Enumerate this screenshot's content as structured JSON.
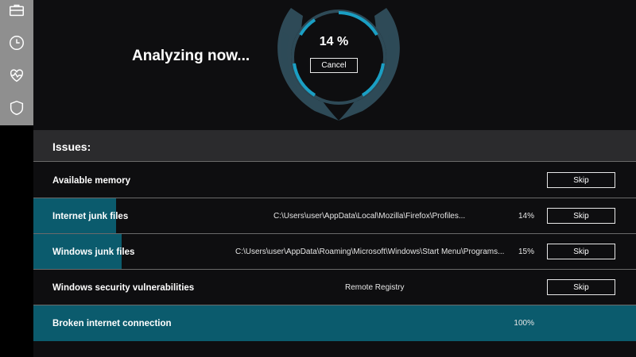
{
  "sidebar": {
    "items": [
      {
        "icon": "briefcase-icon"
      },
      {
        "icon": "clock-icon"
      },
      {
        "icon": "heartbeat-icon"
      },
      {
        "icon": "shield-icon"
      }
    ]
  },
  "scan": {
    "status": "Analyzing now...",
    "progress_label": "14 %",
    "progress": 0.14,
    "cancel_label": "Cancel"
  },
  "issues": {
    "header": "Issues:",
    "rows": [
      {
        "title": "Available memory",
        "path": "",
        "percent": "",
        "progress": 0,
        "skip_label": "Skip"
      },
      {
        "title": "Internet junk files",
        "path": "C:\\Users\\user\\AppData\\Local\\Mozilla\\Firefox\\Profiles...",
        "percent": "14%",
        "progress": 0.14,
        "skip_label": "Skip"
      },
      {
        "title": "Windows junk files",
        "path": "C:\\Users\\user\\AppData\\Roaming\\Microsoft\\Windows\\Start Menu\\Programs...",
        "percent": "15%",
        "progress": 0.15,
        "skip_label": "Skip"
      },
      {
        "title": "Windows security vulnerabilities",
        "path": "Remote Registry",
        "percent": "",
        "progress": 0,
        "skip_label": "Skip"
      },
      {
        "title": "Broken internet connection",
        "path": "",
        "percent": "100%",
        "progress": 1.0,
        "skip_label": ""
      }
    ]
  },
  "colors": {
    "accent": "#0b5b6d",
    "gauge_arc": "#1a9fc4",
    "gauge_wing": "#2e4a57",
    "sidebar": "#8f8f8f",
    "background": "#0e0e10"
  }
}
